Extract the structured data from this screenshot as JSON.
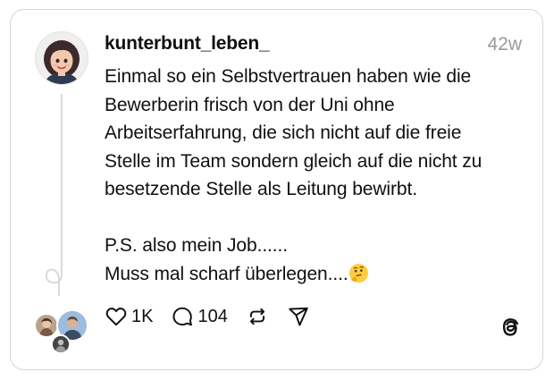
{
  "post": {
    "username": "kunterbunt_leben_",
    "timestamp": "42w",
    "text": "Einmal so ein Selbstvertrauen haben wie die\nBewerberin frisch von der Uni ohne\nArbeitserfahrung, die sich nicht auf die freie\nStelle im Team sondern gleich auf die nicht zu\nbesetzende Stelle als Leitung bewirbt.\n\nP.S. also mein Job......\nMuss mal scharf überlegen....",
    "emoji": "🤔"
  },
  "actions": {
    "likes": "1K",
    "replies": "104"
  },
  "icons": {
    "avatar": "avatar-icon",
    "like": "heart-icon",
    "reply": "comment-icon",
    "repost": "repost-icon",
    "share": "send-icon",
    "brand": "threads-logo-icon"
  },
  "colors": {
    "text": "#101010",
    "muted": "#9a9a9a",
    "border": "#d6d6d6"
  }
}
